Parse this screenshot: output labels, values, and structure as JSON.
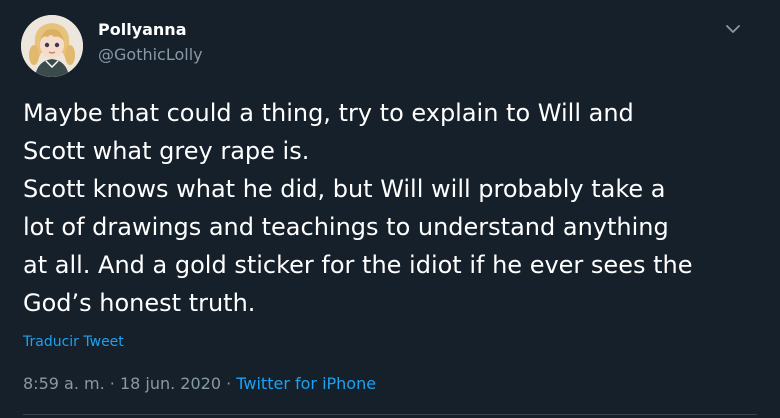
{
  "author": {
    "display_name": "Pollyanna",
    "handle": "@GothicLolly",
    "avatar_icon": "avatar-blonde-character-icon"
  },
  "menu_icon": "chevron-down-icon",
  "tweet": {
    "lines": [
      "Maybe that could a thing, try to explain to Will and",
      "Scott what grey rape is.",
      "Scott knows what he did, but Will will probably take a",
      "lot of drawings and teachings to understand anything",
      "at all. And a gold sticker for the idiot if he ever sees the",
      "God’s honest truth."
    ]
  },
  "translate_label": "Traducir Tweet",
  "meta": {
    "time": "8:59 a. m.",
    "separator": "·",
    "date": "18 jun. 2020",
    "source": "Twitter for iPhone"
  },
  "colors": {
    "background": "#15202b",
    "accent": "#1da1f2",
    "secondary_text": "#8899a6"
  }
}
